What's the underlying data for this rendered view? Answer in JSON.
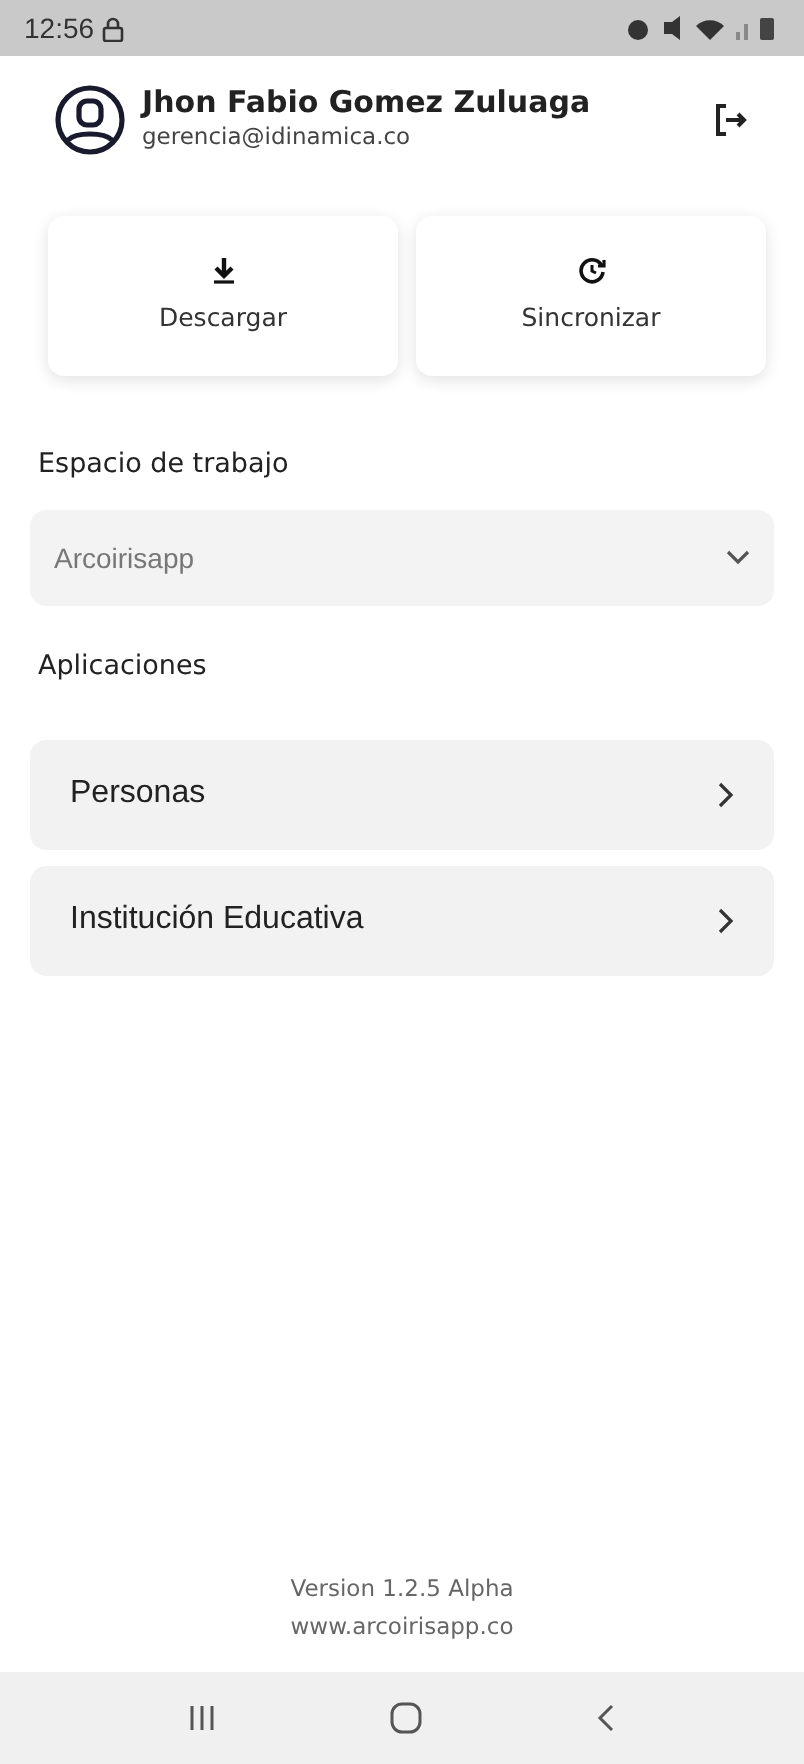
{
  "status_bar": {
    "time": "12:56"
  },
  "user": {
    "name": "Jhon Fabio Gomez Zuluaga",
    "email": "gerencia@idinamica.co"
  },
  "actions": [
    {
      "kind": "download",
      "label": "Descargar"
    },
    {
      "kind": "sync",
      "label": "Sincronizar"
    }
  ],
  "workspace": {
    "label": "Espacio de trabajo",
    "value": "Arcoirisapp"
  },
  "applications": {
    "title": "Aplicaciones",
    "items": [
      {
        "label": "Personas"
      },
      {
        "label": "Institución Educativa"
      }
    ]
  },
  "footer": {
    "version": "Version 1.2.5 Alpha",
    "website": "www.arcoirisapp.co"
  }
}
